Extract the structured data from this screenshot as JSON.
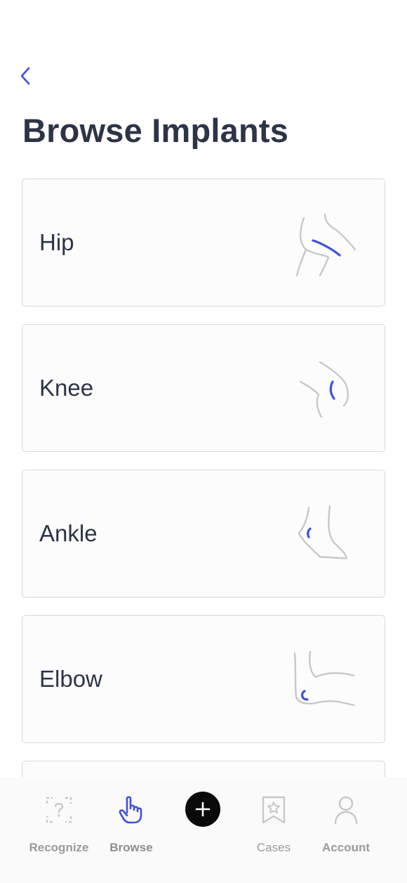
{
  "header": {
    "title": "Browse Implants"
  },
  "categories": [
    {
      "label": "Hip"
    },
    {
      "label": "Knee"
    },
    {
      "label": "Ankle"
    },
    {
      "label": "Elbow"
    }
  ],
  "tabbar": {
    "tabs": [
      {
        "label": "Recognize",
        "icon": "scan-question-icon"
      },
      {
        "label": "Browse",
        "icon": "hand-pointer-icon",
        "active": true
      },
      {
        "label": "Cases",
        "icon": "bookmark-star-icon"
      },
      {
        "label": "Account",
        "icon": "user-icon"
      }
    ],
    "add_icon": "plus-icon"
  },
  "colors": {
    "accent": "#3f51d6",
    "text": "#2d3448",
    "outline": "#c8c8cc"
  }
}
